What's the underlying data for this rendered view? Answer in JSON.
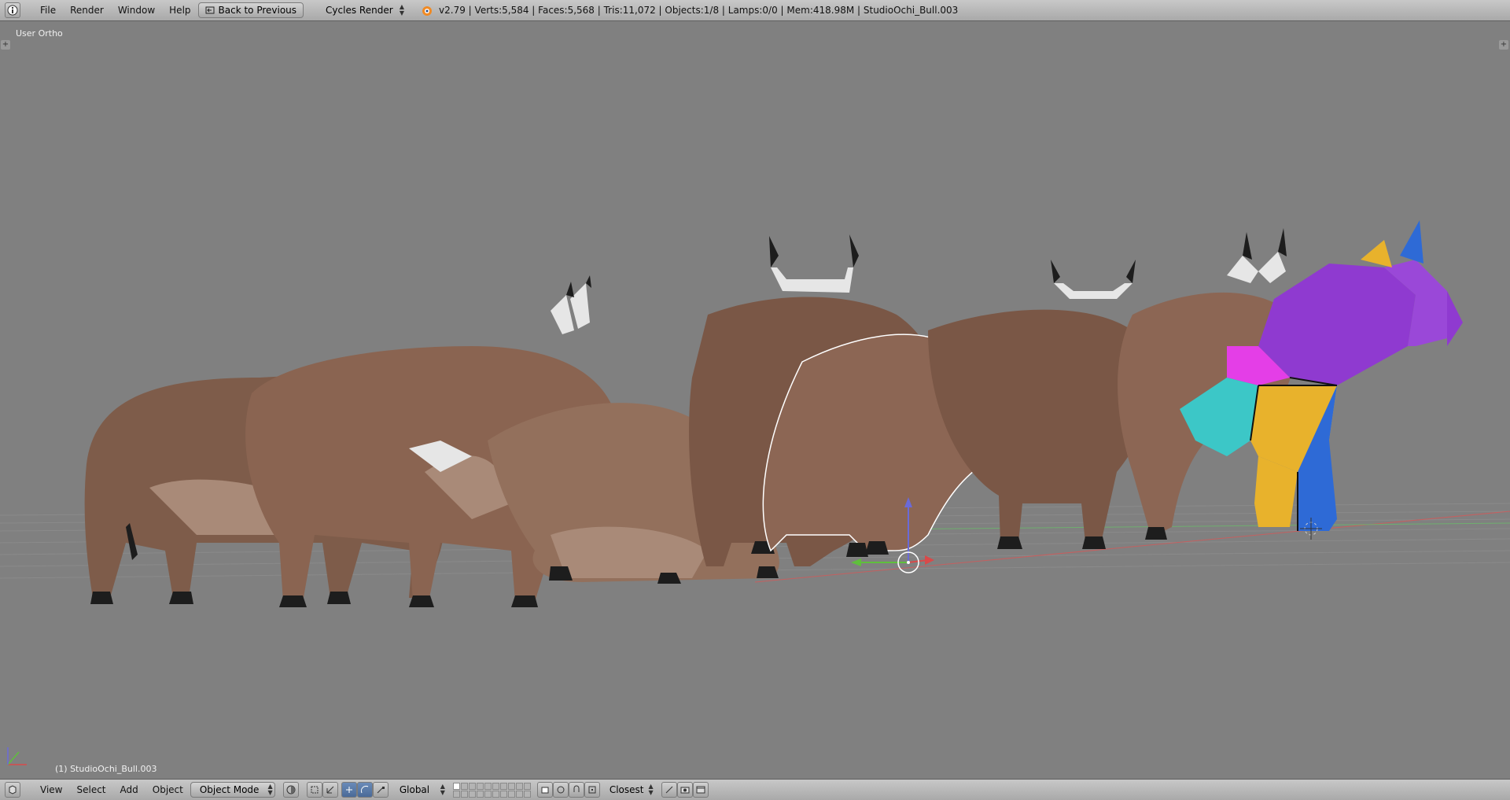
{
  "top_bar": {
    "menus": [
      "File",
      "Render",
      "Window",
      "Help"
    ],
    "back_button": "Back to Previous",
    "render_engine": "Cycles Render",
    "scene_info": "v2.79 | Verts:5,584 | Faces:5,568 | Tris:11,072 | Objects:1/8 | Lamps:0/0 | Mem:418.98M | StudioOchi_Bull.003"
  },
  "viewport": {
    "view_label": "User Ortho",
    "object_label": "(1) StudioOchi_Bull.003",
    "object_colors": {
      "bull_base": "#7e5c4a",
      "bull_light": "#a98a78",
      "horn": "#e6e6e6",
      "hoof": "#1d1d1d",
      "uv_purple": "#8f3ad0",
      "uv_magenta": "#e43ee7",
      "uv_cyan": "#3cc7c7",
      "uv_yellow": "#e8b22c",
      "uv_blue": "#2e6ad6",
      "selection_outline": "#ffffff"
    }
  },
  "bottom_bar": {
    "menus": [
      "View",
      "Select",
      "Add",
      "Object"
    ],
    "mode": "Object Mode",
    "orientation": "Global",
    "snap_target": "Closest"
  }
}
